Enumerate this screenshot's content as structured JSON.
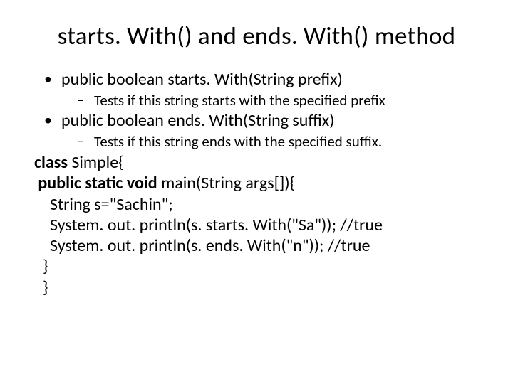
{
  "title": "starts. With() and ends. With() method",
  "bullets": {
    "b1": "public boolean starts. With(String prefix)",
    "b1s": "Tests if this string starts with the specified prefix",
    "b2": "public boolean ends. With(String suffix)",
    "b2s": "Tests if this string ends with the specified suffix."
  },
  "code": {
    "l1a": "class",
    "l1b": " Simple{",
    "l2a": " public static void",
    "l2b": " main(String args[]){",
    "l3": "",
    "l4": "String s=\"Sachin\";",
    "l5": "System. out. println(s. starts. With(\"Sa\")); //true",
    "l6": "System. out. println(s. ends. With(\"n\")); //true",
    "l7": "}",
    "l8": "}"
  }
}
